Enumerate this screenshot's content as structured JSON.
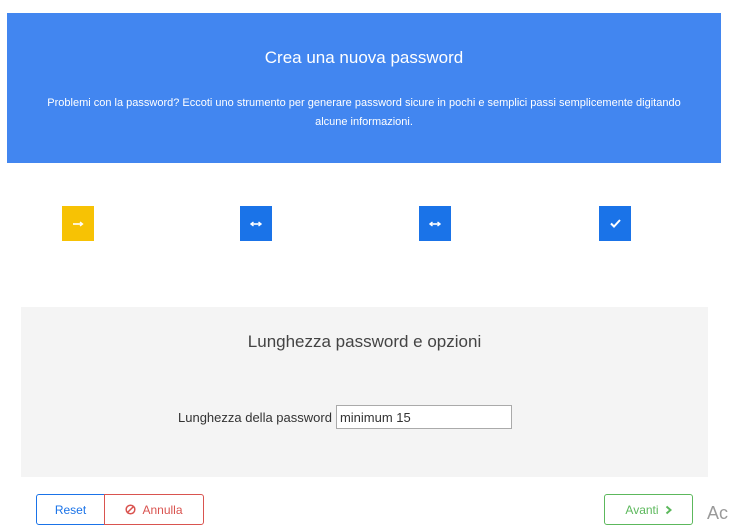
{
  "header": {
    "title": "Crea una nuova password",
    "description": "Problemi con la password? Eccoti uno strumento per generare password sicure in pochi e semplici passi semplicemente digitando alcune informazioni."
  },
  "steps": [
    {
      "state": "active",
      "icon": "arrows-right-icon",
      "color": "#f7c204"
    },
    {
      "state": "pending",
      "icon": "arrows-horizontal-icon",
      "color": "#1a73e8"
    },
    {
      "state": "pending",
      "icon": "arrows-horizontal-icon",
      "color": "#1a73e8"
    },
    {
      "state": "pending",
      "icon": "check-icon",
      "color": "#1a73e8"
    }
  ],
  "panel": {
    "title": "Lunghezza password e opzioni",
    "length_label": "Lunghezza della password",
    "length_value": "",
    "length_placeholder": "minimum 15"
  },
  "footer": {
    "reset_label": "Reset",
    "cancel_label": "Annulla",
    "next_label": "Avanti"
  },
  "watermark": "Ac",
  "colors": {
    "banner": "#4286f0",
    "active_step": "#f7c204",
    "primary": "#1a73e8",
    "danger": "#d9534f",
    "success": "#5cb85c"
  }
}
